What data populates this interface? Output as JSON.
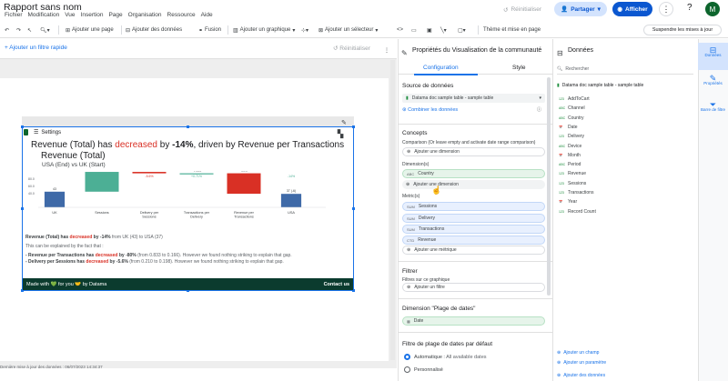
{
  "app": {
    "title": "Rapport sans nom"
  },
  "menu": [
    "Fichier",
    "Modification",
    "Vue",
    "Insertion",
    "Page",
    "Organisation",
    "Ressource",
    "Aide"
  ],
  "header": {
    "reinit": "Réinitialiser",
    "share": "Partager",
    "view": "Afficher",
    "avatar": "M"
  },
  "toolbar": {
    "add_page": "Ajouter une page",
    "add_data": "Ajouter des données",
    "merge": "Fusion",
    "add_chart": "Ajouter un graphique",
    "add_selector": "Ajouter un sélecteur",
    "theme": "Thème et mise en page",
    "suspend": "Suspendre les mises à jour"
  },
  "filterbar": {
    "add_filter": "+ Ajouter un filtre rapide",
    "reinit": "Réinitialiser"
  },
  "widget": {
    "settings": "Settings",
    "title_a": "Revenue (Total) has ",
    "title_dec": "decreased",
    "title_b": " by ",
    "title_pct": "-14%",
    "title_c": ", driven by Revenue per Transactions",
    "sub1": "Revenue (Total)",
    "sub2": "USA (End) vs UK (Start)",
    "line1_a": "Revenue (Total) has ",
    "line1_b": "decreased",
    "line1_c": " by ",
    "line1_d": "-14%",
    "line1_e": " from UK (43) to USA (37)",
    "line2": "This can be explained by the fact that :",
    "line3_a": "- Revenue per Transactions has ",
    "line3_b": "decreased",
    "line3_c": " by -80%",
    "line3_d": " (from 0.833 to 0.166). However we found nothing striking to explain that gap.",
    "line4_a": "- Delivery per Sessions has ",
    "line4_b": "decreased",
    "line4_c": " by -5.6%",
    "line4_d": " (from 0.210 to 0.198). However we found nothing striking to explain that gap.",
    "footer_left": "Made with 💚 for you 🤝 by Datama",
    "footer_right": "Contact us"
  },
  "chart_data": {
    "type": "bar",
    "categories": [
      "UK",
      "Sessions",
      "Delivery per Sessions",
      "Transactions per Delivery",
      "Revenue per Transactions",
      "USA"
    ],
    "values": [
      43,
      54.4,
      -3.95,
      0.118,
      -56.3,
      37
    ],
    "value_labels": [
      "43",
      "+54.4",
      "-3.95",
      "+0.118",
      "-56.3",
      "37 (-6)"
    ],
    "pct_labels": [
      "",
      "+260%",
      "-5.6%",
      "+0.71%",
      "-80%",
      "-14%"
    ],
    "y_ticks": [
      "80.0",
      "60.0",
      "40.0"
    ],
    "colors": {
      "start": "#3f6aa8",
      "up": "#4caf95",
      "down": "#d93025",
      "end": "#3f6aa8"
    }
  },
  "status": "Dernière mise à jour des données : 06/07/2023 14:34:37",
  "props": {
    "title": "Propriétés du Visualisation de la communauté",
    "tab_config": "Configuration",
    "tab_style": "Style",
    "source_h": "Source de données",
    "source_name": "Datama doc sample table - sample table",
    "blend": "Combiner les données",
    "concepts_h": "Concepts",
    "comparison": "Comparison (Or leave empty and activate date range comparison)",
    "add_dim": "Ajouter une dimension",
    "dimension_h": "Dimension(s)",
    "dim_country": "Country",
    "dim_tag": "ABC",
    "add_dim2": "Ajouter une dimension",
    "metrics_h": "Metric(s)",
    "metrics": [
      "Sessions",
      "Delivery",
      "Transactions",
      "Revenue"
    ],
    "metric_tags": [
      "SUM",
      "SUM",
      "SUM",
      "CTD"
    ],
    "add_metric": "Ajouter une métrique",
    "filter_h": "Filtrer",
    "filter_sub": "Filtres sur ce graphique",
    "add_filter": "Ajouter un filtre",
    "dates_h": "Dimension \"Plage de dates\"",
    "date_field": "Date",
    "range_h": "Filtre de plage de dates par défaut",
    "auto": "Automatique",
    "auto_note": "All available dates",
    "custom": "Personnalisé"
  },
  "data_panel": {
    "title": "Données",
    "search": "Rechercher",
    "source": "Datama doc sample table - sample table",
    "fields": [
      "AddToCart",
      "Channel",
      "Country",
      "Date",
      "Delivery",
      "Device",
      "Month",
      "Period",
      "Revenue",
      "Sessions",
      "Transactions",
      "Year",
      "Record Count"
    ],
    "field_tags": [
      "123",
      "ABC",
      "ABC",
      "📅",
      "123",
      "ABC",
      "📅",
      "ABC",
      "123",
      "123",
      "123",
      "📅",
      "123"
    ],
    "add_field": "Ajouter un champ",
    "add_param": "Ajouter un paramètre",
    "add_data": "Ajouter des données"
  },
  "rail": {
    "data": "Données",
    "props": "Propriétés",
    "filter": "Barre de filtre"
  }
}
